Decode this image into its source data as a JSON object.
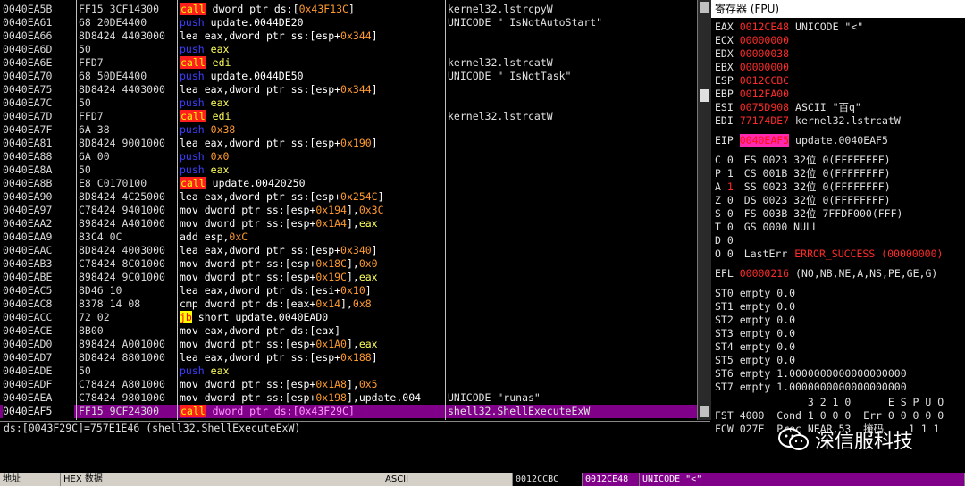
{
  "disasm": {
    "rows": [
      {
        "addr": "0040EA5B",
        "hex": "FF15 3CF14300",
        "m": "call",
        "mc": "call",
        "ops": [
          [
            "dword ptr ds:[",
            "op"
          ],
          [
            "0x43F13C",
            "op-mem"
          ],
          [
            "]",
            "op"
          ]
        ],
        "cmt": "kernel32.lstrcpyW"
      },
      {
        "addr": "0040EA61",
        "hex": "68 20DE4400",
        "m": "push",
        "mc": "push",
        "ops": [
          [
            "update.0044DE20",
            "op"
          ]
        ],
        "cmt": "UNICODE \" IsNotAutoStart\""
      },
      {
        "addr": "0040EA66",
        "hex": "8D8424 4403000",
        "m": "lea",
        "mc": "lea",
        "ops": [
          [
            "eax,dword ptr ss:[esp+",
            "op"
          ],
          [
            "0x344",
            "op-mem"
          ],
          [
            "]",
            "op"
          ]
        ],
        "cmt": ""
      },
      {
        "addr": "0040EA6D",
        "hex": "50",
        "m": "push",
        "mc": "push",
        "ops": [
          [
            "eax",
            "op-reg"
          ]
        ],
        "cmt": ""
      },
      {
        "addr": "0040EA6E",
        "hex": "FFD7",
        "m": "call",
        "mc": "call",
        "ops": [
          [
            "edi",
            "op-reg"
          ]
        ],
        "cmt": "kernel32.lstrcatW"
      },
      {
        "addr": "0040EA70",
        "hex": "68 50DE4400",
        "m": "push",
        "mc": "push",
        "ops": [
          [
            "update.0044DE50",
            "op"
          ]
        ],
        "cmt": "UNICODE \" IsNotTask\""
      },
      {
        "addr": "0040EA75",
        "hex": "8D8424 4403000",
        "m": "lea",
        "mc": "lea",
        "ops": [
          [
            "eax,dword ptr ss:[esp+",
            "op"
          ],
          [
            "0x344",
            "op-mem"
          ],
          [
            "]",
            "op"
          ]
        ],
        "cmt": ""
      },
      {
        "addr": "0040EA7C",
        "hex": "50",
        "m": "push",
        "mc": "push",
        "ops": [
          [
            "eax",
            "op-reg"
          ]
        ],
        "cmt": ""
      },
      {
        "addr": "0040EA7D",
        "hex": "FFD7",
        "m": "call",
        "mc": "call",
        "ops": [
          [
            "edi",
            "op-reg"
          ]
        ],
        "cmt": "kernel32.lstrcatW"
      },
      {
        "addr": "0040EA7F",
        "hex": "6A 38",
        "m": "push",
        "mc": "push",
        "ops": [
          [
            "0x38",
            "op-imm"
          ]
        ],
        "cmt": ""
      },
      {
        "addr": "0040EA81",
        "hex": "8D8424 9001000",
        "m": "lea",
        "mc": "lea",
        "ops": [
          [
            "eax,dword ptr ss:[esp+",
            "op"
          ],
          [
            "0x190",
            "op-mem"
          ],
          [
            "]",
            "op"
          ]
        ],
        "cmt": ""
      },
      {
        "addr": "0040EA88",
        "hex": "6A 00",
        "m": "push",
        "mc": "push",
        "ops": [
          [
            "0x0",
            "op-imm"
          ]
        ],
        "cmt": ""
      },
      {
        "addr": "0040EA8A",
        "hex": "50",
        "m": "push",
        "mc": "push",
        "ops": [
          [
            "eax",
            "op-reg"
          ]
        ],
        "cmt": ""
      },
      {
        "addr": "0040EA8B",
        "hex": "E8 C0170100",
        "m": "call",
        "mc": "call",
        "ops": [
          [
            "update.00420250",
            "op"
          ]
        ],
        "cmt": ""
      },
      {
        "addr": "0040EA90",
        "hex": "8D8424 4C25000",
        "m": "lea",
        "mc": "lea",
        "ops": [
          [
            "eax,dword ptr ss:[esp+",
            "op"
          ],
          [
            "0x254C",
            "op-mem"
          ],
          [
            "]",
            "op"
          ]
        ],
        "cmt": ""
      },
      {
        "addr": "0040EA97",
        "hex": "C78424 9401000",
        "m": "mov",
        "mc": "mov",
        "ops": [
          [
            "dword ptr ss:[esp+",
            "op"
          ],
          [
            "0x194",
            "op-mem"
          ],
          [
            "],",
            "op"
          ],
          [
            "0x3C",
            "op-imm"
          ]
        ],
        "cmt": ""
      },
      {
        "addr": "0040EAA2",
        "hex": "898424 A401000",
        "m": "mov",
        "mc": "mov",
        "ops": [
          [
            "dword ptr ss:[esp+",
            "op"
          ],
          [
            "0x1A4",
            "op-mem"
          ],
          [
            "],",
            "op"
          ],
          [
            "eax",
            "op-reg"
          ]
        ],
        "cmt": ""
      },
      {
        "addr": "0040EAA9",
        "hex": "83C4 0C",
        "m": "add",
        "mc": "add",
        "ops": [
          [
            "esp,",
            "op"
          ],
          [
            "0xC",
            "op-imm"
          ]
        ],
        "cmt": ""
      },
      {
        "addr": "0040EAAC",
        "hex": "8D8424 4003000",
        "m": "lea",
        "mc": "lea",
        "ops": [
          [
            "eax,dword ptr ss:[esp+",
            "op"
          ],
          [
            "0x340",
            "op-mem"
          ],
          [
            "]",
            "op"
          ]
        ],
        "cmt": ""
      },
      {
        "addr": "0040EAB3",
        "hex": "C78424 8C01000",
        "m": "mov",
        "mc": "mov",
        "ops": [
          [
            "dword ptr ss:[esp+",
            "op"
          ],
          [
            "0x18C",
            "op-mem"
          ],
          [
            "],",
            "op"
          ],
          [
            "0x0",
            "op-imm"
          ]
        ],
        "cmt": ""
      },
      {
        "addr": "0040EABE",
        "hex": "898424 9C01000",
        "m": "mov",
        "mc": "mov",
        "ops": [
          [
            "dword ptr ss:[esp+",
            "op"
          ],
          [
            "0x19C",
            "op-mem"
          ],
          [
            "],",
            "op"
          ],
          [
            "eax",
            "op-reg"
          ]
        ],
        "cmt": ""
      },
      {
        "addr": "0040EAC5",
        "hex": "8D46 10",
        "m": "lea",
        "mc": "lea",
        "ops": [
          [
            "eax,dword ptr ds:[esi+",
            "op"
          ],
          [
            "0x10",
            "op-mem"
          ],
          [
            "]",
            "op"
          ]
        ],
        "cmt": ""
      },
      {
        "addr": "0040EAC8",
        "hex": "8378 14 08",
        "m": "cmp",
        "mc": "cmp",
        "ops": [
          [
            "dword ptr ds:[eax+",
            "op"
          ],
          [
            "0x14",
            "op-mem"
          ],
          [
            "],",
            "op"
          ],
          [
            "0x8",
            "op-imm"
          ]
        ],
        "cmt": ""
      },
      {
        "addr": "0040EACC",
        "hex": "72 02",
        "m": "jb",
        "mc": "jb",
        "ops": [
          [
            "short update.0040EAD0",
            "op"
          ]
        ],
        "cmt": ""
      },
      {
        "addr": "0040EACE",
        "hex": "8B00",
        "m": "mov",
        "mc": "mov",
        "ops": [
          [
            "eax,dword ptr ds:[eax]",
            "op"
          ]
        ],
        "cmt": ""
      },
      {
        "addr": "0040EAD0",
        "hex": "898424 A001000",
        "m": "mov",
        "mc": "mov",
        "ops": [
          [
            "dword ptr ss:[esp+",
            "op"
          ],
          [
            "0x1A0",
            "op-mem"
          ],
          [
            "],",
            "op"
          ],
          [
            "eax",
            "op-reg"
          ]
        ],
        "cmt": ""
      },
      {
        "addr": "0040EAD7",
        "hex": "8D8424 8801000",
        "m": "lea",
        "mc": "lea",
        "ops": [
          [
            "eax,dword ptr ss:[esp+",
            "op"
          ],
          [
            "0x188",
            "op-mem"
          ],
          [
            "]",
            "op"
          ]
        ],
        "cmt": ""
      },
      {
        "addr": "0040EADE",
        "hex": "50",
        "m": "push",
        "mc": "push",
        "ops": [
          [
            "eax",
            "op-reg"
          ]
        ],
        "cmt": ""
      },
      {
        "addr": "0040EADF",
        "hex": "C78424 A801000",
        "m": "mov",
        "mc": "mov",
        "ops": [
          [
            "dword ptr ss:[esp+",
            "op"
          ],
          [
            "0x1A8",
            "op-mem"
          ],
          [
            "],",
            "op"
          ],
          [
            "0x5",
            "op-imm"
          ]
        ],
        "cmt": ""
      },
      {
        "addr": "0040EAEA",
        "hex": "C78424 9801000",
        "m": "mov",
        "mc": "mov",
        "ops": [
          [
            "dword ptr ss:[esp+",
            "op"
          ],
          [
            "0x198",
            "op-mem"
          ],
          [
            "],update.004",
            "op"
          ]
        ],
        "cmt": "UNICODE \"runas\""
      },
      {
        "addr": "0040EAF5",
        "hex": "FF15 9CF24300",
        "m": "call",
        "mc": "call",
        "ops": [
          [
            "dword ptr ds:[",
            "op"
          ],
          [
            "0x43F29C",
            "op-mem"
          ],
          [
            "]",
            "op"
          ]
        ],
        "cmt": "shell32.ShellExecuteExW",
        "sel": true
      }
    ]
  },
  "info": {
    "line1": "ds:[0043F29C]=757E1E46 (shell32.ShellExecuteExW)"
  },
  "registers": {
    "title": "寄存器 (FPU)",
    "gp": [
      {
        "n": "EAX",
        "v": "0012CE48",
        "t": "UNICODE \"<\""
      },
      {
        "n": "ECX",
        "v": "00000000",
        "t": ""
      },
      {
        "n": "EDX",
        "v": "00000038",
        "t": ""
      },
      {
        "n": "EBX",
        "v": "00000000",
        "t": ""
      },
      {
        "n": "ESP",
        "v": "0012CCBC",
        "t": ""
      },
      {
        "n": "EBP",
        "v": "0012FA00",
        "t": ""
      },
      {
        "n": "ESI",
        "v": "0075D908",
        "t": "ASCII \"百q\""
      },
      {
        "n": "EDI",
        "v": "77174DE7",
        "t": "kernel32.lstrcatW"
      }
    ],
    "eip": {
      "n": "EIP",
      "v": "0040EAF5",
      "t": "update.0040EAF5"
    },
    "flags": [
      {
        "f": "C 0",
        "s": "ES 0023 32位 0(FFFFFFFF)",
        "red": false
      },
      {
        "f": "P 1",
        "s": "CS 001B 32位 0(FFFFFFFF)",
        "red": false
      },
      {
        "f": "A 1",
        "s": "SS 0023 32位 0(FFFFFFFF)",
        "red": true
      },
      {
        "f": "Z 0",
        "s": "DS 0023 32位 0(FFFFFFFF)",
        "red": false
      },
      {
        "f": "S 0",
        "s": "FS 003B 32位 7FFDF000(FFF)",
        "red": false
      },
      {
        "f": "T 0",
        "s": "GS 0000 NULL",
        "red": false
      },
      {
        "f": "D 0",
        "s": "",
        "red": false
      }
    ],
    "lasterr": {
      "f": "O 0",
      "label": "LastErr",
      "v": "ERROR_SUCCESS (00000000)"
    },
    "efl": {
      "n": "EFL",
      "v": "00000216",
      "t": "(NO,NB,NE,A,NS,PE,GE,G)"
    },
    "st": [
      "ST0 empty 0.0",
      "ST1 empty 0.0",
      "ST2 empty 0.0",
      "ST3 empty 0.0",
      "ST4 empty 0.0",
      "ST5 empty 0.0",
      "ST6 empty 1.0000000000000000000",
      "ST7 empty 1.0000000000000000000"
    ],
    "fst_hdr": "               3 2 1 0      E S P U O",
    "fst": "FST 4000  Cond 1 0 0 0  Err 0 0 0 0 0",
    "fcw": "FCW 027F  Prec NEAR,53  掩码    1 1 1"
  },
  "bottom": {
    "addr_label": "地址",
    "hex_label": "HEX 数据",
    "ascii_label": "ASCII",
    "stack_addr": "0012CCBC",
    "stack_val": "0012CE48",
    "stack_cmt": "UNICODE \"<\""
  },
  "watermark": {
    "text": "深信服科技",
    "icon": "wechat-icon"
  }
}
